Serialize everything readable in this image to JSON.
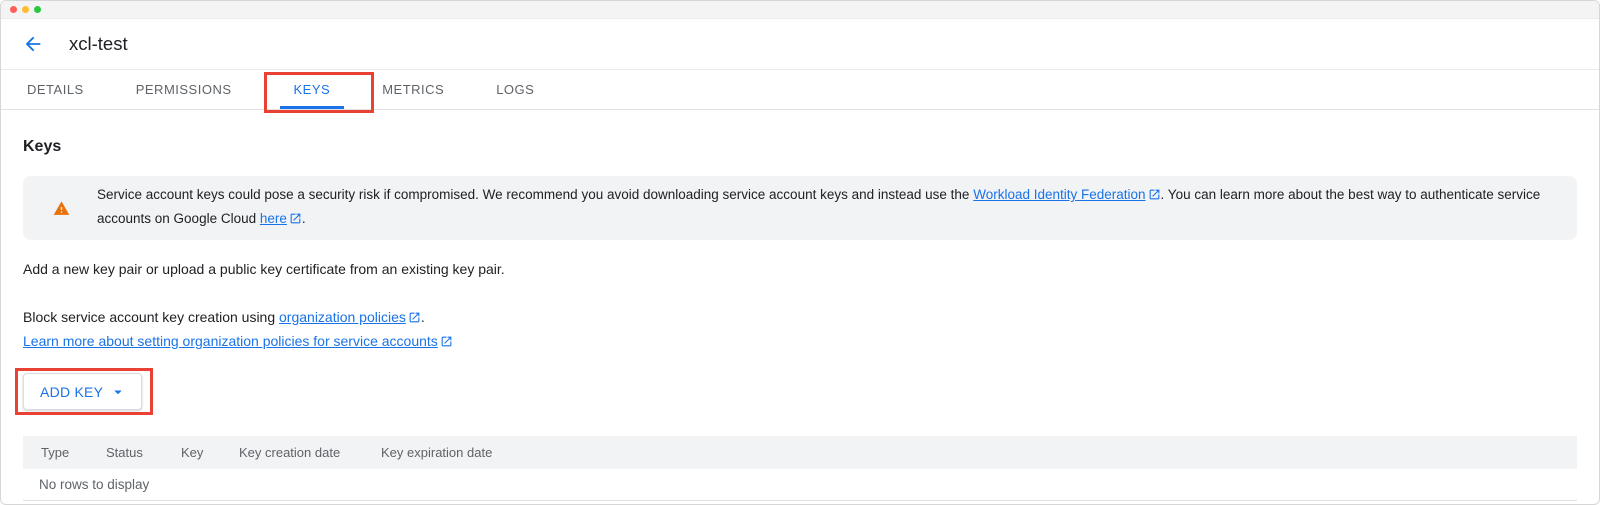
{
  "header": {
    "title": "xcl-test"
  },
  "tabs": [
    {
      "label": "DETAILS"
    },
    {
      "label": "PERMISSIONS"
    },
    {
      "label": "KEYS"
    },
    {
      "label": "METRICS"
    },
    {
      "label": "LOGS"
    }
  ],
  "active_tab": "KEYS",
  "content": {
    "heading": "Keys",
    "warning_banner": {
      "icon": "warning-triangle",
      "text_before_link1": "Service account keys could pose a security risk if compromised. We recommend you avoid downloading service account keys and instead use the ",
      "link1": "Workload Identity Federation",
      "text_between": ". You can learn more about the best way to authenticate service accounts on Google Cloud ",
      "link2": "here",
      "text_after": "."
    },
    "intro": "Add a new key pair or upload a public key certificate from an existing key pair.",
    "block_line": {
      "text": "Block service account key creation using ",
      "link": "organization policies",
      "suffix": "."
    },
    "learn_more_link": "Learn more about setting organization policies for service accounts",
    "add_key_button": "ADD KEY"
  },
  "table": {
    "headers": [
      "Type",
      "Status",
      "Key",
      "Key creation date",
      "Key expiration date"
    ],
    "empty_message": "No rows to display"
  },
  "colors": {
    "accent_blue": "#1a73e8",
    "annotation_red": "#e94235",
    "warning_orange": "#e8710a"
  }
}
